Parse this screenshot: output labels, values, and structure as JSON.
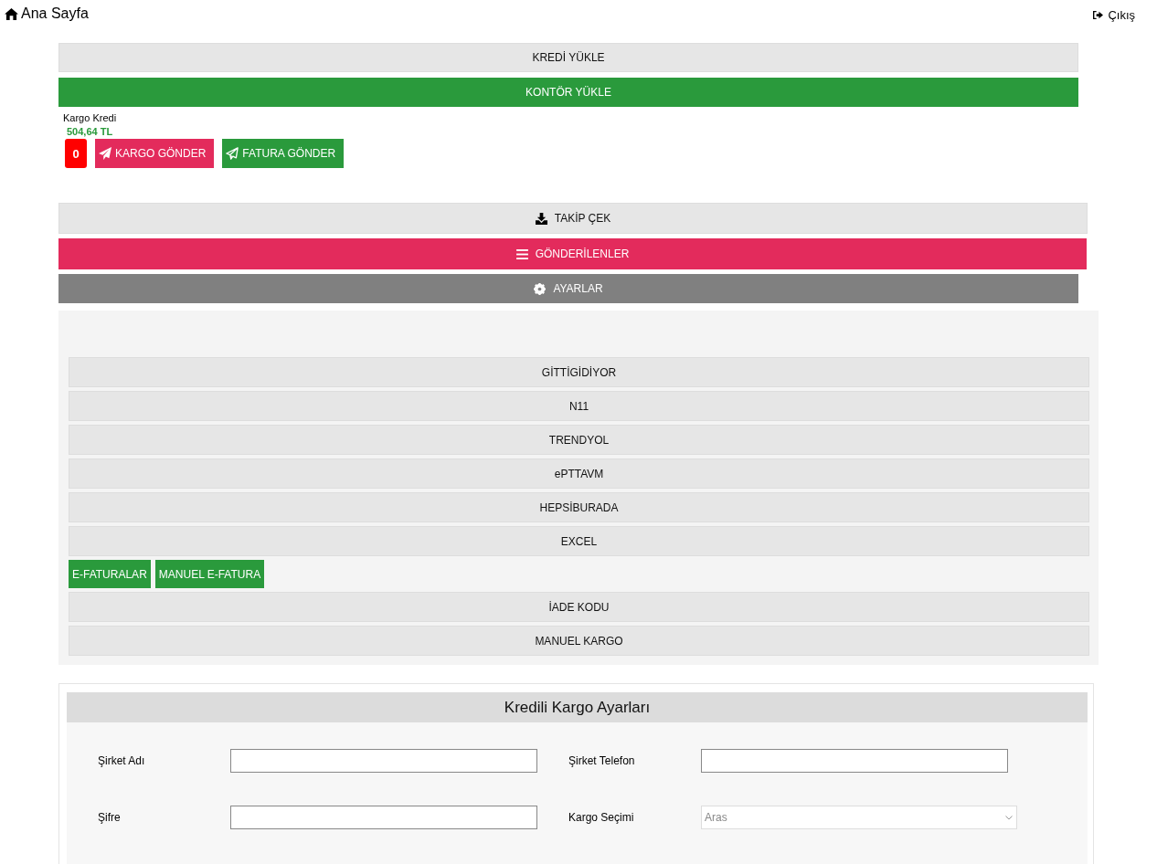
{
  "header": {
    "home": "Ana Sayfa",
    "logout": "Çıkış"
  },
  "load_buttons": [
    {
      "label": "KREDİ YÜKLE",
      "kind": "light"
    },
    {
      "label": "KONTÖR YÜKLE",
      "kind": "green"
    }
  ],
  "credit": {
    "label": "Kargo Kredi",
    "value": "504,64 TL"
  },
  "actions": {
    "count": "0",
    "buttons": [
      {
        "label": "KARGO GÖNDER",
        "kind": "pink"
      },
      {
        "label": "FATURA GÖNDER",
        "kind": "green"
      }
    ]
  },
  "menu": [
    {
      "label": "TAKİP ÇEK",
      "kind": "tracking"
    },
    {
      "label": "GÖNDERİLENLER",
      "kind": "sent"
    },
    {
      "label": "AYARLAR",
      "kind": "settings"
    }
  ],
  "settings_panel": {
    "items": [
      {
        "kind": "bar",
        "label": "GİTTİGİDİYOR"
      },
      {
        "kind": "bar",
        "label": "N11"
      },
      {
        "kind": "bar",
        "label": "TRENDYOL"
      },
      {
        "kind": "bar",
        "label": "ePTTAVM"
      },
      {
        "kind": "bar",
        "label": "HEPSİBURADA"
      },
      {
        "kind": "bar",
        "label": "EXCEL"
      },
      {
        "kind": "buttons",
        "buttons": [
          "E-FATURALAR",
          "MANUEL E-FATURA"
        ]
      },
      {
        "kind": "bar",
        "label": "İADE KODU"
      },
      {
        "kind": "bar",
        "label": "MANUEL KARGO"
      }
    ]
  },
  "form": {
    "title": "Kredili Kargo Ayarları",
    "fields": [
      {
        "label": "Şirket Adı",
        "kind": "text"
      },
      {
        "label": "Şirket Telefon",
        "kind": "text"
      },
      {
        "label": "Şifre",
        "kind": "text"
      },
      {
        "label": "Kargo Seçimi",
        "kind": "select",
        "value": "Aras"
      }
    ]
  }
}
